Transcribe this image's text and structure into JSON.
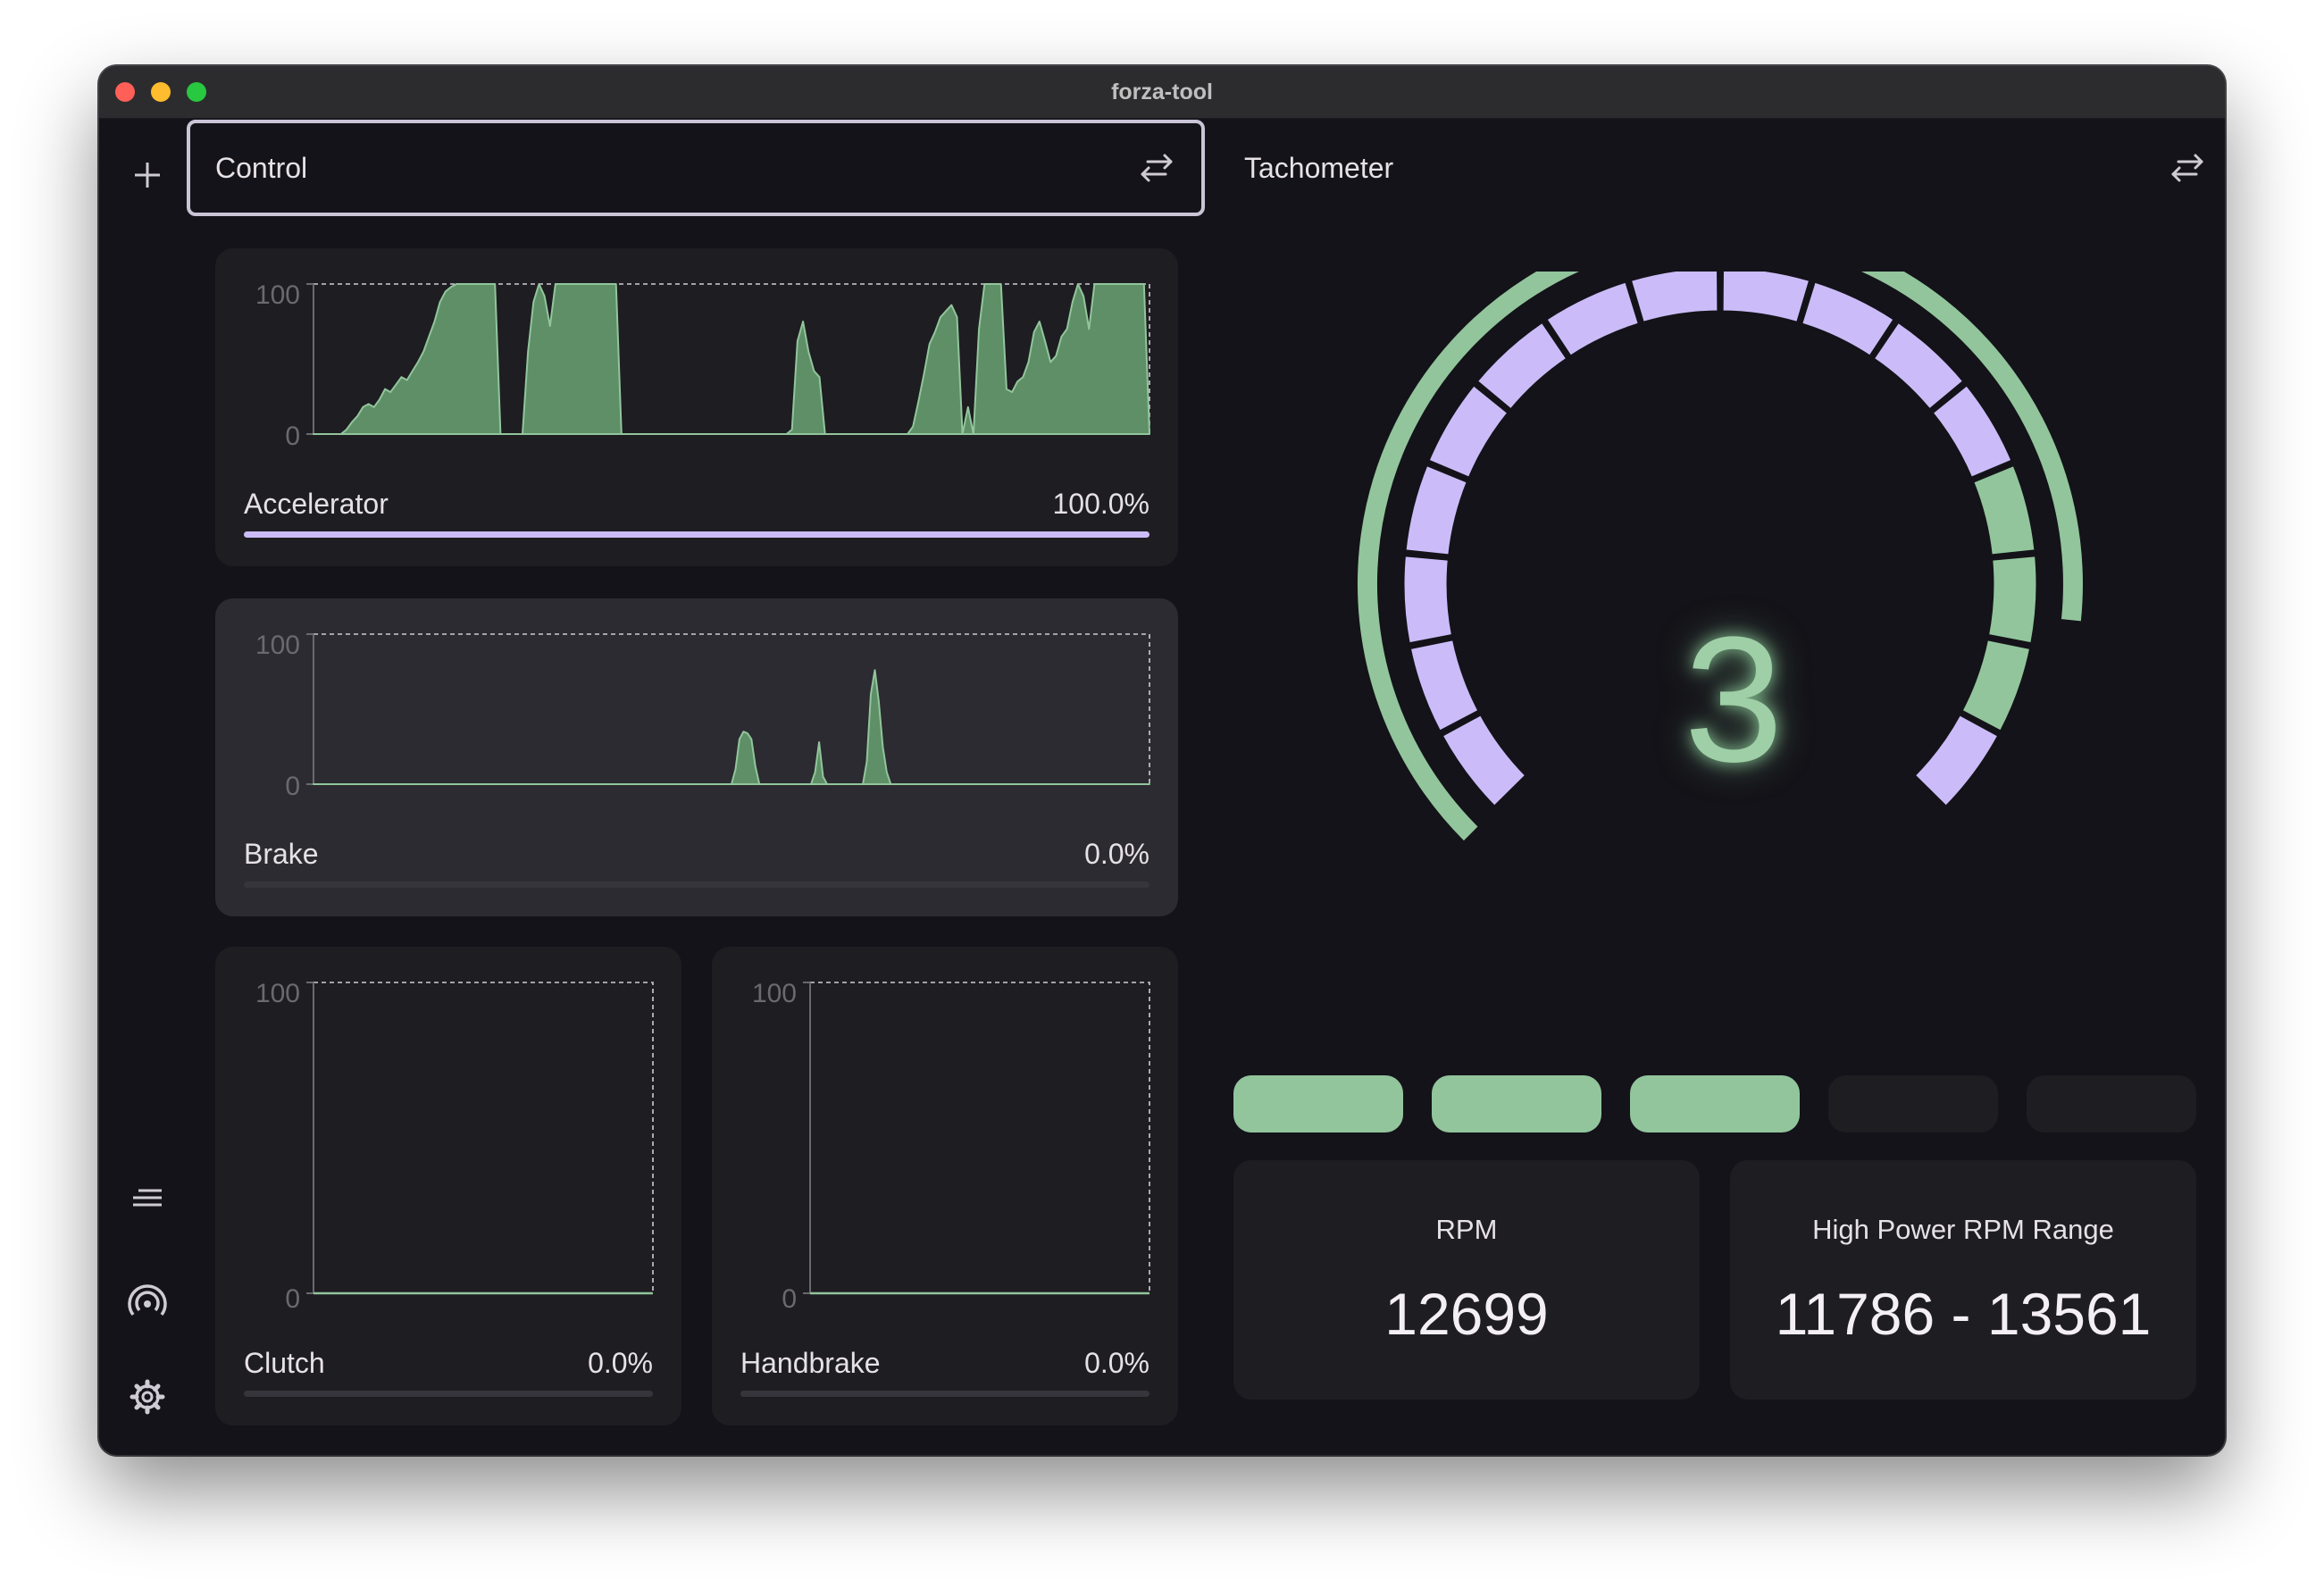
{
  "window": {
    "title": "forza-tool"
  },
  "rail": {
    "add_icon": "plus-icon",
    "list_icon": "lines-icon",
    "signal_icon": "broadcast-icon",
    "settings_icon": "gear-icon"
  },
  "control_panel": {
    "title": "Control",
    "swap_icon": "swap-arrows-icon",
    "charts": [
      {
        "label": "Accelerator",
        "value_text": "100.0%",
        "fraction": 1.0,
        "y_max_label": "100",
        "y_min_label": "0",
        "series": [
          0,
          0,
          0,
          0,
          0,
          0,
          3,
          8,
          12,
          18,
          20,
          18,
          23,
          30,
          28,
          33,
          38,
          36,
          42,
          48,
          55,
          65,
          75,
          88,
          95,
          98,
          100,
          100,
          100,
          100,
          100,
          100,
          100,
          100,
          0,
          0,
          0,
          0,
          0,
          55,
          88,
          100,
          92,
          72,
          100,
          100,
          100,
          100,
          100,
          100,
          100,
          100,
          100,
          100,
          100,
          100,
          0,
          0,
          0,
          0,
          0,
          0,
          0,
          0,
          0,
          0,
          0,
          0,
          0,
          0,
          0,
          0,
          0,
          0,
          0,
          0,
          0,
          0,
          0,
          0,
          0,
          0,
          0,
          0,
          0,
          0,
          0,
          3,
          62,
          75,
          55,
          42,
          38,
          0,
          0,
          0,
          0,
          0,
          0,
          0,
          0,
          0,
          0,
          0,
          0,
          0,
          0,
          0,
          0,
          5,
          22,
          40,
          60,
          68,
          78,
          82,
          86,
          78,
          0,
          18,
          0,
          70,
          100,
          100,
          100,
          100,
          30,
          28,
          35,
          38,
          48,
          68,
          75,
          62,
          48,
          52,
          65,
          70,
          88,
          100,
          92,
          70,
          100,
          100,
          100,
          100,
          100,
          100,
          100,
          100,
          100,
          100,
          0
        ]
      },
      {
        "label": "Brake",
        "value_text": "0.0%",
        "fraction": 0.0,
        "y_max_label": "100",
        "y_min_label": "0",
        "series": [
          0,
          0,
          0,
          0,
          0,
          0,
          0,
          0,
          0,
          0,
          0,
          0,
          0,
          0,
          0,
          0,
          0,
          0,
          0,
          0,
          0,
          0,
          0,
          0,
          0,
          0,
          0,
          0,
          0,
          0,
          0,
          0,
          0,
          0,
          0,
          0,
          0,
          0,
          0,
          0,
          0,
          0,
          0,
          0,
          0,
          0,
          0,
          0,
          0,
          0,
          0,
          0,
          0,
          0,
          0,
          0,
          0,
          0,
          0,
          0,
          0,
          0,
          0,
          0,
          0,
          0,
          0,
          0,
          0,
          0,
          0,
          0,
          0,
          0,
          0,
          0,
          0,
          0,
          0,
          0,
          0,
          0,
          0,
          0,
          0,
          0,
          0,
          0,
          0,
          0,
          0,
          0,
          0,
          0,
          0,
          0,
          0,
          0,
          0,
          0,
          0,
          0,
          0,
          0,
          0,
          0,
          10,
          30,
          35,
          34,
          30,
          12,
          0,
          0,
          0,
          0,
          0,
          0,
          0,
          0,
          0,
          0,
          0,
          0,
          0,
          0,
          8,
          28,
          5,
          0,
          0,
          0,
          0,
          0,
          0,
          0,
          0,
          0,
          0,
          15,
          60,
          76,
          55,
          25,
          8,
          0,
          0,
          0,
          0,
          0,
          0,
          0,
          0,
          0,
          0,
          0,
          0,
          0,
          0,
          0,
          0,
          0,
          0,
          0,
          0,
          0,
          0,
          0,
          0,
          0,
          0,
          0,
          0,
          0,
          0,
          0,
          0,
          0,
          0,
          0,
          0,
          0,
          0,
          0,
          0,
          0,
          0,
          0,
          0,
          0,
          0,
          0,
          0,
          0,
          0,
          0,
          0,
          0,
          0,
          0,
          0,
          0,
          0,
          0,
          0,
          0,
          0,
          0,
          0,
          0,
          0
        ]
      },
      {
        "label": "Clutch",
        "value_text": "0.0%",
        "fraction": 0.0,
        "y_max_label": "100",
        "y_min_label": "0",
        "series": []
      },
      {
        "label": "Handbrake",
        "value_text": "0.0%",
        "fraction": 0.0,
        "y_max_label": "100",
        "y_min_label": "0",
        "series": []
      }
    ]
  },
  "tachometer_panel": {
    "title": "Tachometer",
    "swap_icon": "swap-arrows-icon",
    "gear": "3",
    "segments_total": 16,
    "segments_lit": 3,
    "outer_arc_fraction": 0.855,
    "shift_lights": [
      true,
      true,
      true,
      false,
      false
    ],
    "rpm_label": "RPM",
    "rpm_value": "12699",
    "power_range_label": "High Power RPM Range",
    "power_range_value": "11786 - 13561"
  },
  "colors": {
    "accent_purple": "#cbbcf9",
    "accent_green": "#92c59c",
    "background": "#141319",
    "card": "#1e1d22"
  }
}
